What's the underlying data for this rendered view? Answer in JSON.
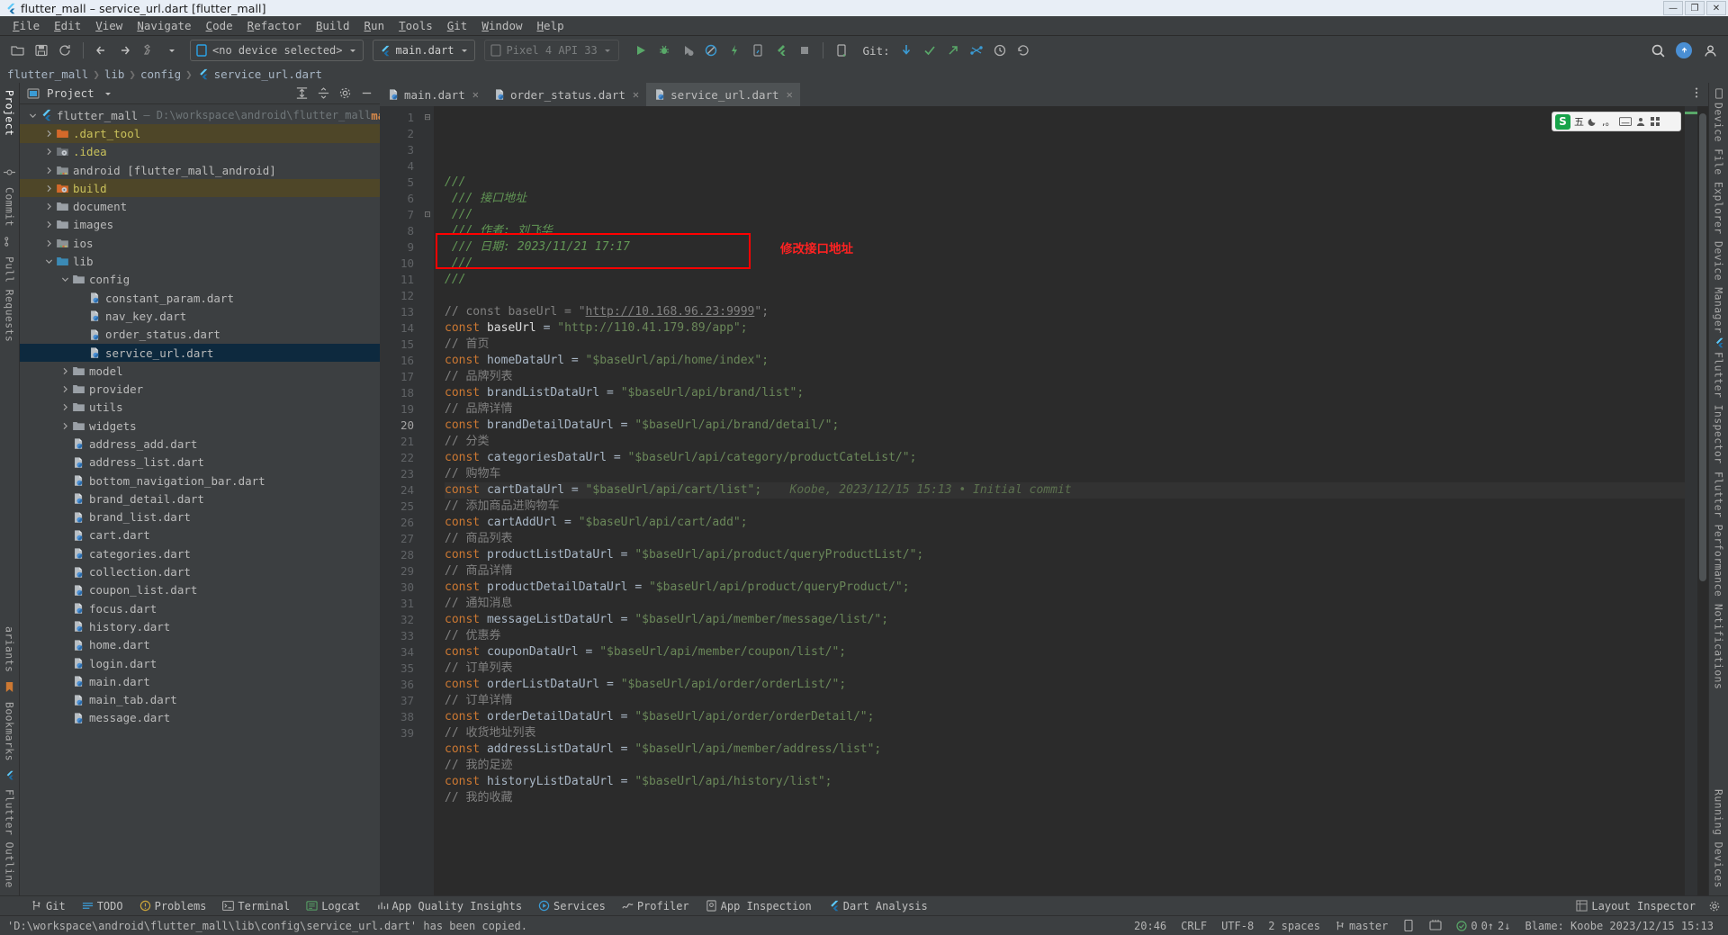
{
  "window": {
    "title": "flutter_mall – service_url.dart [flutter_mall]",
    "minimize": "—",
    "maximize": "❐",
    "close": "✕"
  },
  "menubar": [
    {
      "label": "File"
    },
    {
      "label": "Edit"
    },
    {
      "label": "View"
    },
    {
      "label": "Navigate"
    },
    {
      "label": "Code"
    },
    {
      "label": "Refactor"
    },
    {
      "label": "Build"
    },
    {
      "label": "Run"
    },
    {
      "label": "Tools"
    },
    {
      "label": "Git"
    },
    {
      "label": "Window"
    },
    {
      "label": "Help"
    }
  ],
  "toolbar": {
    "device_selector": "<no device selected>",
    "run_config": "main.dart",
    "emulator": "Pixel 4 API 33",
    "git_label": "Git:",
    "icons": [
      "open-folder-icon",
      "save-icon",
      "sync-icon",
      "back-arrow-icon",
      "forward-arrow-icon",
      "build-hammer-icon",
      "run-icon",
      "debug-icon",
      "run-coverage-icon",
      "profile-icon",
      "flash-hot-reload-icon",
      "device-mirror-icon",
      "flutter-attach-icon",
      "stop-icon",
      "device-manager-icon",
      "git-update-icon",
      "git-commit-icon",
      "git-push-icon",
      "git-branch-icon",
      "history-icon",
      "undo-icon",
      "search-everywhere-icon",
      "notifications-icon",
      "account-icon"
    ]
  },
  "breadcrumb": {
    "items": [
      "flutter_mall",
      "lib",
      "config",
      "service_url.dart"
    ],
    "separator": "❯"
  },
  "left_strip": {
    "top": [
      "Project"
    ],
    "middle": [
      "Commit",
      "Pull Requests"
    ],
    "bottom": [
      "Flutter Outline",
      "ariants",
      "Bookmarks"
    ]
  },
  "right_strip": {
    "items": [
      "Device File Explorer",
      "Device Manager",
      "Flutter Inspector",
      "Flutter Performance",
      "Notifications",
      "Running Devices"
    ]
  },
  "project_panel": {
    "title": "Project",
    "dropdown_caret": "▾",
    "actions": [
      "expand-all-icon",
      "collapse-all-icon",
      "settings-gear-icon",
      "hide-icon"
    ],
    "tree": [
      {
        "depth": 0,
        "arrow": "v",
        "icon": "flutter-icon",
        "label": "flutter_mall",
        "path": "D:\\workspace\\android\\flutter_mall",
        "branch": "master",
        "state": "none"
      },
      {
        "depth": 1,
        "arrow": ">",
        "icon": "folder-orange-icon",
        "label": ".dart_tool",
        "labelClass": "label-yellow",
        "state": "brown"
      },
      {
        "depth": 1,
        "arrow": ">",
        "icon": "folder-idea-icon",
        "label": ".idea",
        "labelClass": "label-yellow",
        "state": "none"
      },
      {
        "depth": 1,
        "arrow": ">",
        "icon": "folder-module-icon",
        "label": "android [flutter_mall_android]",
        "state": "none"
      },
      {
        "depth": 1,
        "arrow": ">",
        "icon": "folder-orange-idea-icon",
        "label": "build",
        "labelClass": "label-yellow",
        "state": "brown"
      },
      {
        "depth": 1,
        "arrow": ">",
        "icon": "folder-icon",
        "label": "document",
        "state": "none"
      },
      {
        "depth": 1,
        "arrow": ">",
        "icon": "folder-icon",
        "label": "images",
        "state": "none"
      },
      {
        "depth": 1,
        "arrow": ">",
        "icon": "folder-module-icon",
        "label": "ios",
        "state": "none"
      },
      {
        "depth": 1,
        "arrow": "v",
        "icon": "folder-blue-icon",
        "label": "lib",
        "state": "none"
      },
      {
        "depth": 2,
        "arrow": "v",
        "icon": "folder-icon",
        "label": "config",
        "state": "none"
      },
      {
        "depth": 3,
        "arrow": "",
        "icon": "dart-file-icon",
        "label": "constant_param.dart",
        "state": "none"
      },
      {
        "depth": 3,
        "arrow": "",
        "icon": "dart-file-icon",
        "label": "nav_key.dart",
        "state": "none"
      },
      {
        "depth": 3,
        "arrow": "",
        "icon": "dart-file-icon",
        "label": "order_status.dart",
        "state": "none"
      },
      {
        "depth": 3,
        "arrow": "",
        "icon": "dart-file-icon",
        "label": "service_url.dart",
        "state": "blue"
      },
      {
        "depth": 2,
        "arrow": ">",
        "icon": "folder-icon",
        "label": "model",
        "state": "none"
      },
      {
        "depth": 2,
        "arrow": ">",
        "icon": "folder-icon",
        "label": "provider",
        "state": "none"
      },
      {
        "depth": 2,
        "arrow": ">",
        "icon": "folder-icon",
        "label": "utils",
        "state": "none"
      },
      {
        "depth": 2,
        "arrow": ">",
        "icon": "folder-icon",
        "label": "widgets",
        "state": "none"
      },
      {
        "depth": 2,
        "arrow": "",
        "icon": "dart-file-icon",
        "label": "address_add.dart",
        "state": "none"
      },
      {
        "depth": 2,
        "arrow": "",
        "icon": "dart-file-icon",
        "label": "address_list.dart",
        "state": "none"
      },
      {
        "depth": 2,
        "arrow": "",
        "icon": "dart-file-icon",
        "label": "bottom_navigation_bar.dart",
        "state": "none"
      },
      {
        "depth": 2,
        "arrow": "",
        "icon": "dart-file-icon",
        "label": "brand_detail.dart",
        "state": "none"
      },
      {
        "depth": 2,
        "arrow": "",
        "icon": "dart-file-icon",
        "label": "brand_list.dart",
        "state": "none"
      },
      {
        "depth": 2,
        "arrow": "",
        "icon": "dart-file-icon",
        "label": "cart.dart",
        "state": "none"
      },
      {
        "depth": 2,
        "arrow": "",
        "icon": "dart-file-icon",
        "label": "categories.dart",
        "state": "none"
      },
      {
        "depth": 2,
        "arrow": "",
        "icon": "dart-file-icon",
        "label": "collection.dart",
        "state": "none"
      },
      {
        "depth": 2,
        "arrow": "",
        "icon": "dart-file-icon",
        "label": "coupon_list.dart",
        "state": "none"
      },
      {
        "depth": 2,
        "arrow": "",
        "icon": "dart-file-icon",
        "label": "focus.dart",
        "state": "none"
      },
      {
        "depth": 2,
        "arrow": "",
        "icon": "dart-file-icon",
        "label": "history.dart",
        "state": "none"
      },
      {
        "depth": 2,
        "arrow": "",
        "icon": "dart-file-icon",
        "label": "home.dart",
        "state": "none"
      },
      {
        "depth": 2,
        "arrow": "",
        "icon": "dart-file-icon",
        "label": "login.dart",
        "state": "none"
      },
      {
        "depth": 2,
        "arrow": "",
        "icon": "dart-file-icon",
        "label": "main.dart",
        "state": "none"
      },
      {
        "depth": 2,
        "arrow": "",
        "icon": "dart-file-icon",
        "label": "main_tab.dart",
        "state": "none"
      },
      {
        "depth": 2,
        "arrow": "",
        "icon": "dart-file-icon",
        "label": "message.dart",
        "state": "none"
      }
    ]
  },
  "editor": {
    "tabs": [
      {
        "label": "main.dart",
        "active": false,
        "close": "✕"
      },
      {
        "label": "order_status.dart",
        "active": false,
        "close": "✕"
      },
      {
        "label": "service_url.dart",
        "active": true,
        "close": "✕"
      }
    ],
    "annotation": "Koobe, 2023/12/15 15:13 • Initial commit",
    "red_note": "修改接口地址",
    "lines": [
      {
        "n": 1,
        "fold": "⊟",
        "segs": [
          {
            "t": "///",
            "c": "cmt-i"
          }
        ]
      },
      {
        "n": 2,
        "fold": "",
        "segs": [
          {
            "t": " /// 接口地址",
            "c": "cmt-i"
          }
        ]
      },
      {
        "n": 3,
        "fold": "",
        "segs": [
          {
            "t": " ///",
            "c": "cmt-i"
          }
        ]
      },
      {
        "n": 4,
        "fold": "",
        "segs": [
          {
            "t": " /// 作者: 刘飞华",
            "c": "cmt-i"
          }
        ]
      },
      {
        "n": 5,
        "fold": "",
        "segs": [
          {
            "t": " /// 日期: 2023/11/21 17:17",
            "c": "cmt-i"
          }
        ]
      },
      {
        "n": 6,
        "fold": "",
        "segs": [
          {
            "t": " ///",
            "c": "cmt-i"
          }
        ]
      },
      {
        "n": 7,
        "fold": "⊡",
        "segs": [
          {
            "t": "///",
            "c": "cmt-i"
          }
        ]
      },
      {
        "n": 8,
        "fold": "",
        "segs": []
      },
      {
        "n": 9,
        "fold": "",
        "segs": [
          {
            "t": "// const baseUrl = \"",
            "c": "gray"
          },
          {
            "t": "http://10.168.96.23:9999",
            "c": "gray lnkline"
          },
          {
            "t": "\";",
            "c": "gray"
          }
        ]
      },
      {
        "n": 10,
        "fold": "",
        "segs": [
          {
            "t": "const",
            "c": "kw"
          },
          {
            "t": " ",
            "c": "id"
          },
          {
            "t": "baseUrl",
            "c": "white"
          },
          {
            "t": " = ",
            "c": "id"
          },
          {
            "t": "\"http://110.41.179.89/app\";",
            "c": "str"
          }
        ]
      },
      {
        "n": 11,
        "fold": "",
        "segs": [
          {
            "t": "// 首页",
            "c": "gray"
          }
        ]
      },
      {
        "n": 12,
        "fold": "",
        "segs": [
          {
            "t": "const",
            "c": "kw"
          },
          {
            "t": " homeDataUrl = ",
            "c": "id"
          },
          {
            "t": "\"$baseUrl/api/home/index\";",
            "c": "str"
          }
        ]
      },
      {
        "n": 13,
        "fold": "",
        "segs": [
          {
            "t": "// 品牌列表",
            "c": "gray"
          }
        ]
      },
      {
        "n": 14,
        "fold": "",
        "segs": [
          {
            "t": "const",
            "c": "kw"
          },
          {
            "t": " brandListDataUrl = ",
            "c": "id"
          },
          {
            "t": "\"$baseUrl/api/brand/list\";",
            "c": "str"
          }
        ]
      },
      {
        "n": 15,
        "fold": "",
        "segs": [
          {
            "t": "// 品牌详情",
            "c": "gray"
          }
        ]
      },
      {
        "n": 16,
        "fold": "",
        "segs": [
          {
            "t": "const",
            "c": "kw"
          },
          {
            "t": " brandDetailDataUrl = ",
            "c": "id"
          },
          {
            "t": "\"$baseUrl/api/brand/detail/\";",
            "c": "str"
          }
        ]
      },
      {
        "n": 17,
        "fold": "",
        "segs": [
          {
            "t": "// 分类",
            "c": "gray"
          }
        ]
      },
      {
        "n": 18,
        "fold": "",
        "segs": [
          {
            "t": "const",
            "c": "kw"
          },
          {
            "t": " categoriesDataUrl = ",
            "c": "id"
          },
          {
            "t": "\"$baseUrl/api/category/productCateList/\";",
            "c": "str"
          }
        ]
      },
      {
        "n": 19,
        "fold": "",
        "segs": [
          {
            "t": "// 购物车",
            "c": "gray"
          }
        ]
      },
      {
        "n": 20,
        "fold": "",
        "segs": [
          {
            "t": "const",
            "c": "kw"
          },
          {
            "t": " cartDataUrl = ",
            "c": "id"
          },
          {
            "t": "\"$baseUrl/api/cart/list\";",
            "c": "str"
          }
        ],
        "annotated": true
      },
      {
        "n": 21,
        "fold": "",
        "segs": [
          {
            "t": "// 添加商品进购物车",
            "c": "gray"
          }
        ]
      },
      {
        "n": 22,
        "fold": "",
        "segs": [
          {
            "t": "const",
            "c": "kw"
          },
          {
            "t": " cartAddUrl = ",
            "c": "id"
          },
          {
            "t": "\"$baseUrl/api/cart/add\";",
            "c": "str"
          }
        ]
      },
      {
        "n": 23,
        "fold": "",
        "segs": [
          {
            "t": "// 商品列表",
            "c": "gray"
          }
        ]
      },
      {
        "n": 24,
        "fold": "",
        "segs": [
          {
            "t": "const",
            "c": "kw"
          },
          {
            "t": " productListDataUrl = ",
            "c": "id"
          },
          {
            "t": "\"$baseUrl/api/product/queryProductList/\";",
            "c": "str"
          }
        ]
      },
      {
        "n": 25,
        "fold": "",
        "segs": [
          {
            "t": "// 商品详情",
            "c": "gray"
          }
        ]
      },
      {
        "n": 26,
        "fold": "",
        "segs": [
          {
            "t": "const",
            "c": "kw"
          },
          {
            "t": " productDetailDataUrl = ",
            "c": "id"
          },
          {
            "t": "\"$baseUrl/api/product/queryProduct/\";",
            "c": "str"
          }
        ]
      },
      {
        "n": 27,
        "fold": "",
        "segs": [
          {
            "t": "// 通知消息",
            "c": "gray"
          }
        ]
      },
      {
        "n": 28,
        "fold": "",
        "segs": [
          {
            "t": "const",
            "c": "kw"
          },
          {
            "t": " messageListDataUrl = ",
            "c": "id"
          },
          {
            "t": "\"$baseUrl/api/member/message/list/\";",
            "c": "str"
          }
        ]
      },
      {
        "n": 29,
        "fold": "",
        "segs": [
          {
            "t": "// 优惠券",
            "c": "gray"
          }
        ]
      },
      {
        "n": 30,
        "fold": "",
        "segs": [
          {
            "t": "const",
            "c": "kw"
          },
          {
            "t": " couponDataUrl = ",
            "c": "id"
          },
          {
            "t": "\"$baseUrl/api/member/coupon/list/\";",
            "c": "str"
          }
        ]
      },
      {
        "n": 31,
        "fold": "",
        "segs": [
          {
            "t": "// 订单列表",
            "c": "gray"
          }
        ]
      },
      {
        "n": 32,
        "fold": "",
        "segs": [
          {
            "t": "const",
            "c": "kw"
          },
          {
            "t": " orderListDataUrl = ",
            "c": "id"
          },
          {
            "t": "\"$baseUrl/api/order/orderList/\";",
            "c": "str"
          }
        ]
      },
      {
        "n": 33,
        "fold": "",
        "segs": [
          {
            "t": "// 订单详情",
            "c": "gray"
          }
        ]
      },
      {
        "n": 34,
        "fold": "",
        "segs": [
          {
            "t": "const",
            "c": "kw"
          },
          {
            "t": " orderDetailDataUrl = ",
            "c": "id"
          },
          {
            "t": "\"$baseUrl/api/order/orderDetail/\";",
            "c": "str"
          }
        ]
      },
      {
        "n": 35,
        "fold": "",
        "segs": [
          {
            "t": "// 收货地址列表",
            "c": "gray"
          }
        ]
      },
      {
        "n": 36,
        "fold": "",
        "segs": [
          {
            "t": "const",
            "c": "kw"
          },
          {
            "t": " addressListDataUrl = ",
            "c": "id"
          },
          {
            "t": "\"$baseUrl/api/member/address/list\";",
            "c": "str"
          }
        ]
      },
      {
        "n": 37,
        "fold": "",
        "segs": [
          {
            "t": "// 我的足迹",
            "c": "gray"
          }
        ]
      },
      {
        "n": 38,
        "fold": "",
        "segs": [
          {
            "t": "const",
            "c": "kw"
          },
          {
            "t": " historyListDataUrl = ",
            "c": "id"
          },
          {
            "t": "\"$baseUrl/api/history/list\";",
            "c": "str"
          }
        ]
      },
      {
        "n": 39,
        "fold": "",
        "segs": [
          {
            "t": "// 我的收藏",
            "c": "gray"
          }
        ]
      }
    ]
  },
  "ime": {
    "logo": "S",
    "mode": "五",
    "icons": [
      "moon-icon",
      "punctuation-icon",
      "keyboard-icon",
      "user-icon",
      "menu-icon"
    ]
  },
  "bottom_tools": [
    {
      "label": "Git",
      "icon": "git-icon"
    },
    {
      "label": "TODO",
      "icon": "todo-icon"
    },
    {
      "label": "Problems",
      "icon": "problems-icon"
    },
    {
      "label": "Terminal",
      "icon": "terminal-icon"
    },
    {
      "label": "Logcat",
      "icon": "logcat-icon"
    },
    {
      "label": "App Quality Insights",
      "icon": "insights-icon"
    },
    {
      "label": "Services",
      "icon": "services-icon"
    },
    {
      "label": "Profiler",
      "icon": "profiler-icon"
    },
    {
      "label": "App Inspection",
      "icon": "inspection-icon"
    },
    {
      "label": "Dart Analysis",
      "icon": "dart-analysis-icon"
    }
  ],
  "bottom_right": [
    {
      "label": "Layout Inspector",
      "icon": "layout-inspector-icon"
    }
  ],
  "statusbar": {
    "message": "'D:\\workspace\\android\\flutter_mall\\lib\\config\\service_url.dart' has been copied.",
    "caret": "20:46",
    "line_sep": "CRLF",
    "encoding": "UTF-8",
    "indent": "2 spaces",
    "branch": "master",
    "errors": "0",
    "warnings": "0",
    "ahead": "0↑",
    "behind": "2↓",
    "blame": "Blame: Koobe 2023/12/15 15:13"
  },
  "colors": {
    "accent_blue": "#4a8fd4",
    "red_highlight": "#ff0000",
    "editor_bg": "#2b2b2b",
    "panel_bg": "#3c3f41",
    "selection_blue": "#0d293e",
    "selection_brown": "#4e4628",
    "string_green": "#6a8759",
    "keyword_orange": "#cc7832"
  }
}
